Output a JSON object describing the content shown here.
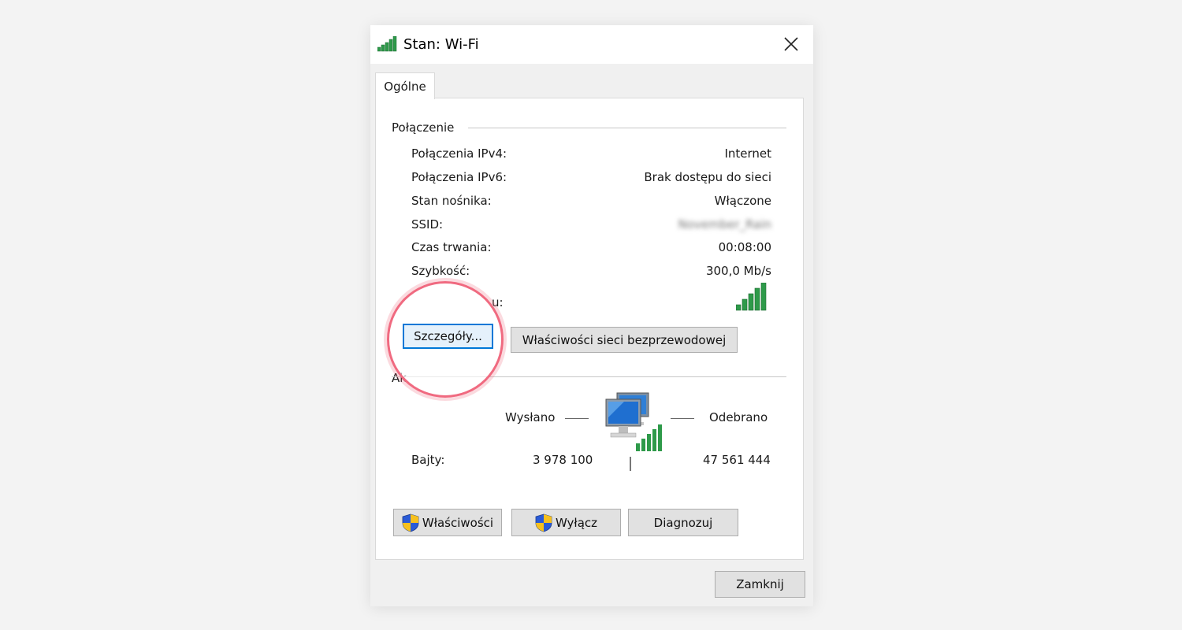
{
  "window": {
    "title": "Stan: Wi-Fi",
    "tab_label": "Ogólne"
  },
  "connection": {
    "group_title": "Połączenie",
    "rows": [
      {
        "label": "Połączenia IPv4:",
        "value": "Internet"
      },
      {
        "label": "Połączenia IPv6:",
        "value": "Brak dostępu do sieci"
      },
      {
        "label": "Stan nośnika:",
        "value": "Włączone"
      },
      {
        "label": "SSID:",
        "value": "November_Rain"
      },
      {
        "label": "Czas trwania:",
        "value": "00:08:00"
      },
      {
        "label": "Szybkość:",
        "value": "300,0 Mb/s"
      }
    ],
    "signal_label_partial": "u:",
    "details_button": "Szczegóły...",
    "wireless_props_button": "Właściwości sieci bezprzewodowej"
  },
  "activity": {
    "group_title_partial": "Ak",
    "sent_label": "Wysłano",
    "received_label": "Odebrano",
    "bytes_label": "Bajty:",
    "bytes_sent": "3 978 100",
    "bytes_received": "47 561 444"
  },
  "buttons": {
    "properties": "Właściwości",
    "disable": "Wyłącz",
    "diagnose": "Diagnozuj",
    "close": "Zamknij"
  },
  "colors": {
    "signal_green": "#2e9a4a",
    "focus_blue": "#0078d7",
    "highlight_pink": "#f06a80"
  }
}
